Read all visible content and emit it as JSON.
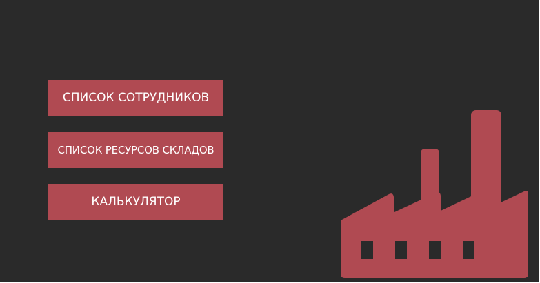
{
  "menu": {
    "employees_label": "СПИСОК СОТРУДНИКОВ",
    "warehouse_resources_label": "СПИСОК РЕСУРСОВ СКЛАДОВ",
    "calculator_label": "КАЛЬКУЛЯТОР"
  },
  "illustration": {
    "icon": "factory-icon",
    "color": "#b04a52"
  },
  "colors": {
    "background": "#2a2a2a",
    "accent": "#b04a52",
    "button_text": "#ffffff"
  }
}
